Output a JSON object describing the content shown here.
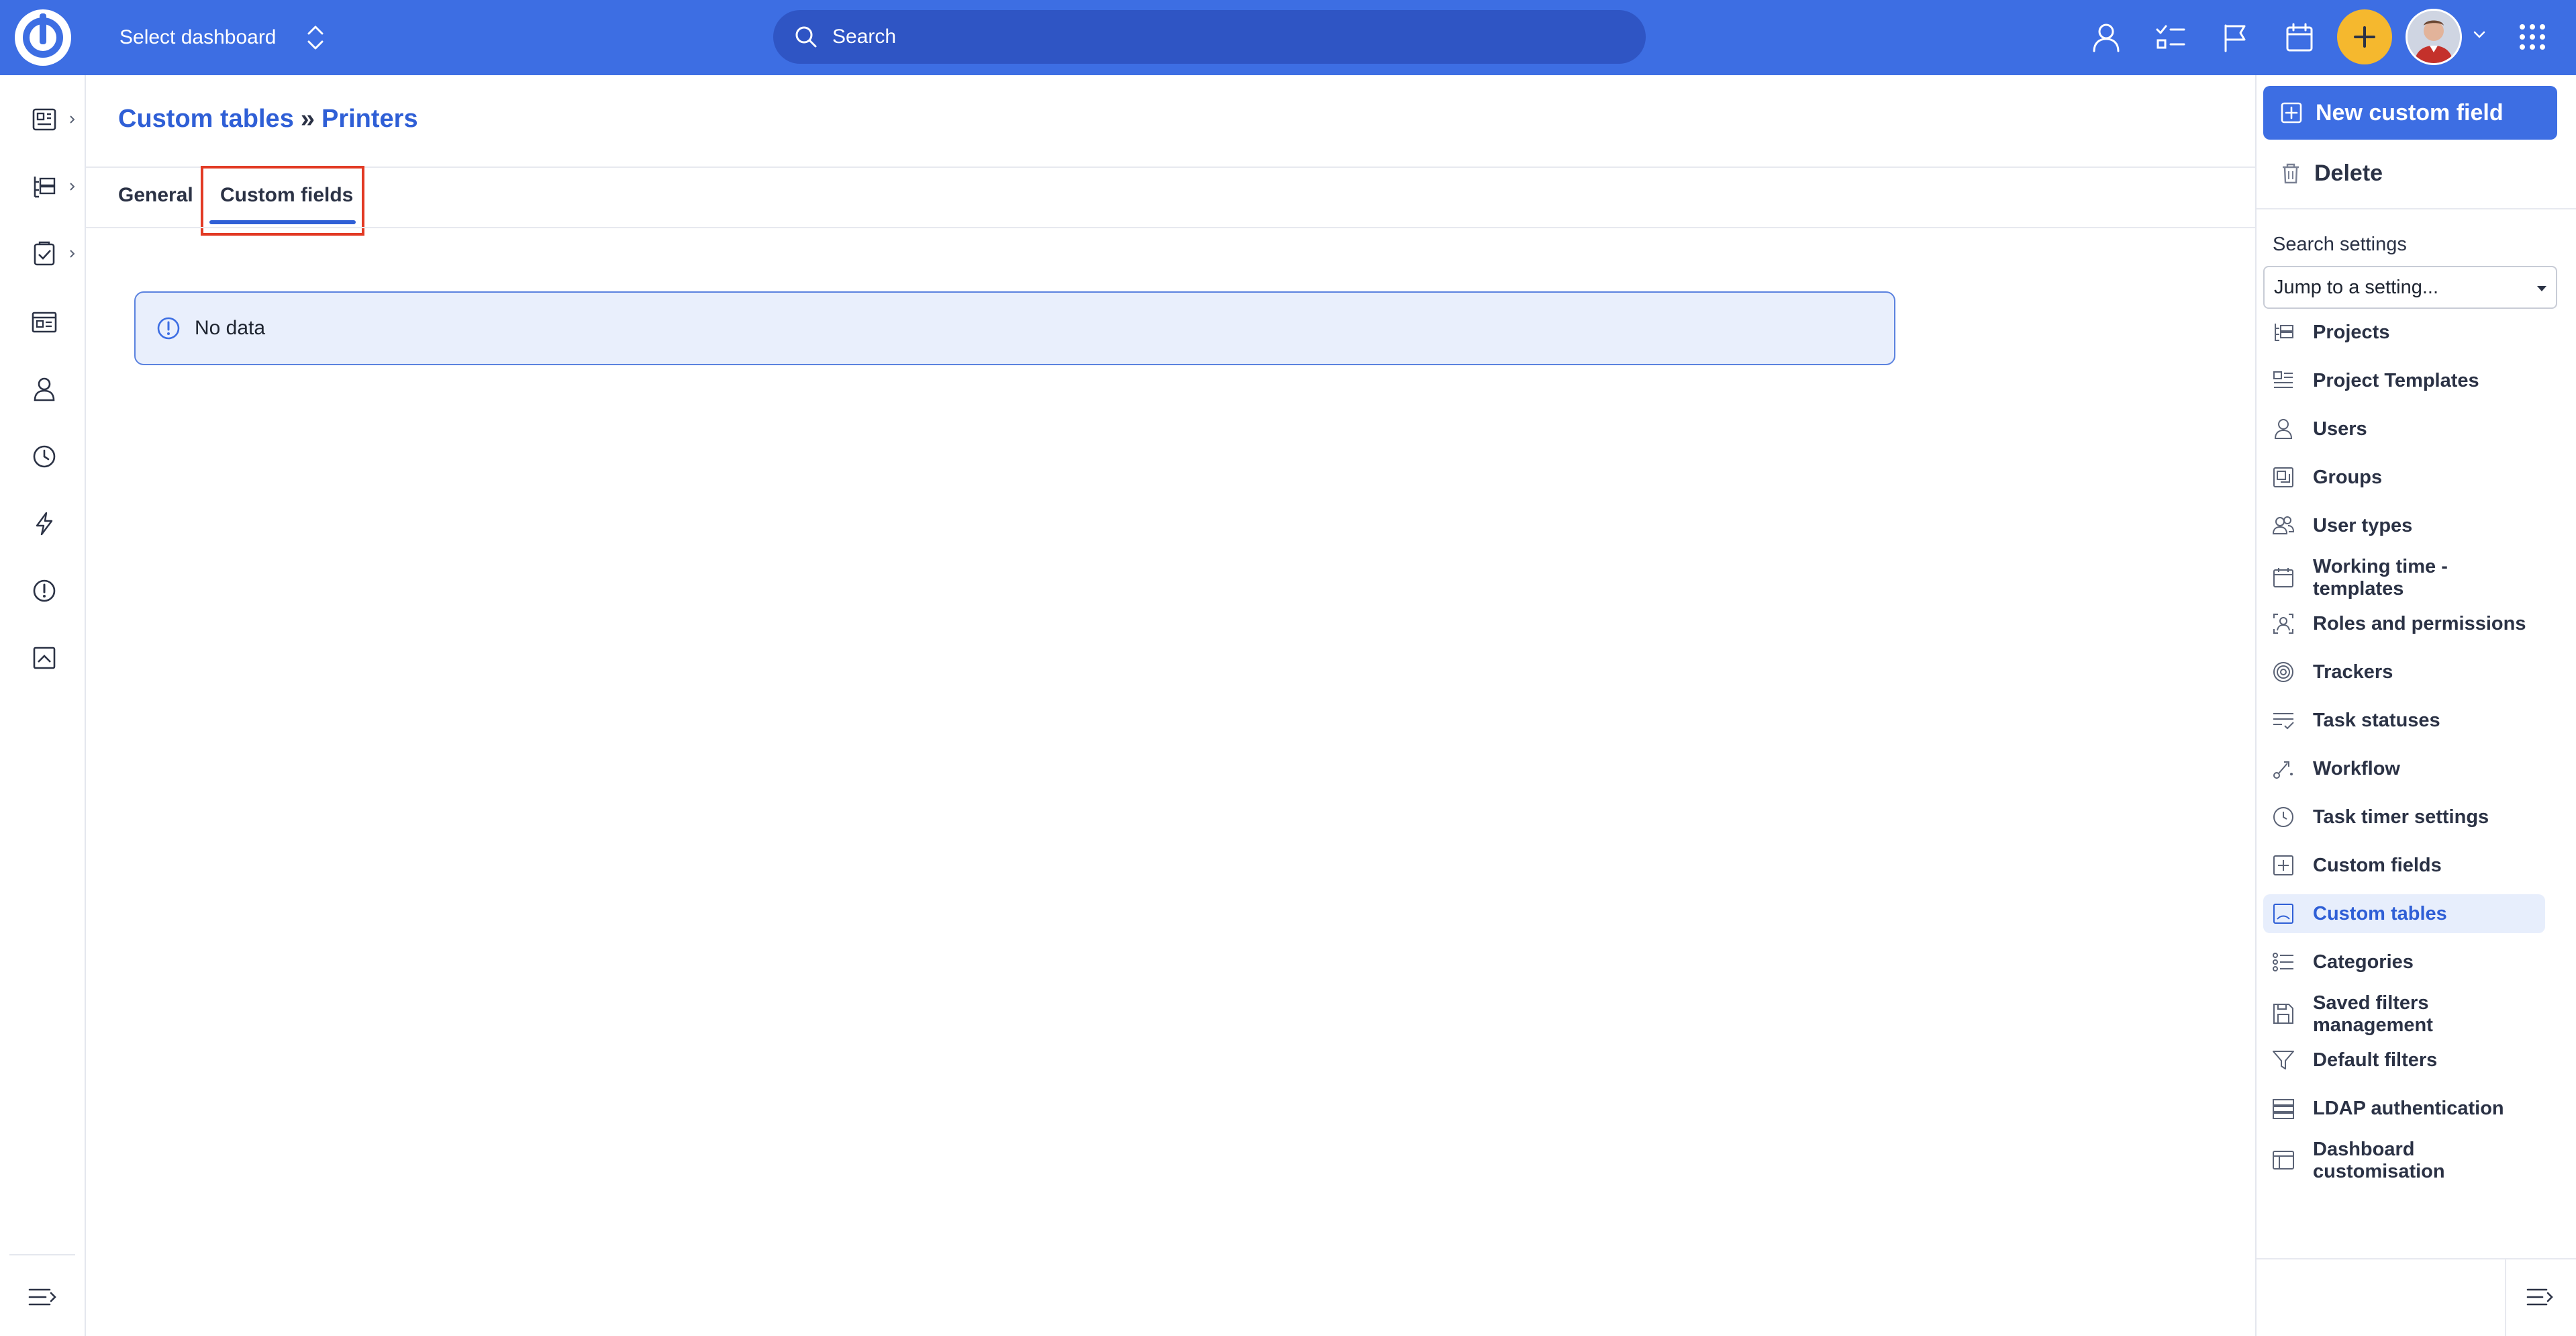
{
  "header": {
    "dashboard_select_label": "Select dashboard",
    "search_placeholder": "Search",
    "accent_color": "#3d6ee3",
    "plus_button_color": "#f5b82e"
  },
  "left_rail": {
    "items": [
      "dashboard-icon",
      "projects-icon",
      "tasks-icon",
      "calendar-board-icon",
      "user-icon",
      "clock-icon",
      "lightning-icon",
      "alert-icon",
      "chart-icon"
    ]
  },
  "breadcrumb": {
    "parent": "Custom tables",
    "separator": "»",
    "current": "Printers"
  },
  "tabs": [
    {
      "label": "General",
      "active": false
    },
    {
      "label": "Custom fields",
      "active": true
    }
  ],
  "notice": {
    "text": "No data",
    "icon": "info-icon"
  },
  "sidebar": {
    "new_button_label": "New custom field",
    "delete_button_label": "Delete",
    "search_settings_label": "Search settings",
    "jump_select_value": "Jump to a setting...",
    "items": [
      {
        "label": "Projects",
        "icon": "projects-tree-icon"
      },
      {
        "label": "Project Templates",
        "icon": "template-icon"
      },
      {
        "label": "Users",
        "icon": "user-icon"
      },
      {
        "label": "Groups",
        "icon": "groups-icon"
      },
      {
        "label": "User types",
        "icon": "user-types-icon"
      },
      {
        "label": "Working time - templates",
        "icon": "calendar-icon"
      },
      {
        "label": "Roles and permissions",
        "icon": "roles-icon"
      },
      {
        "label": "Trackers",
        "icon": "target-icon"
      },
      {
        "label": "Task statuses",
        "icon": "statuses-icon"
      },
      {
        "label": "Workflow",
        "icon": "workflow-icon"
      },
      {
        "label": "Task timer settings",
        "icon": "clock-icon"
      },
      {
        "label": "Custom fields",
        "icon": "plus-square-icon"
      },
      {
        "label": "Custom tables",
        "icon": "table-icon",
        "active": true
      },
      {
        "label": "Categories",
        "icon": "list-icon"
      },
      {
        "label": "Saved filters management",
        "icon": "save-icon"
      },
      {
        "label": "Default filters",
        "icon": "filter-icon"
      },
      {
        "label": "LDAP authentication",
        "icon": "ldap-icon"
      },
      {
        "label": "Dashboard customisation",
        "icon": "dashboard-custom-icon"
      }
    ]
  }
}
